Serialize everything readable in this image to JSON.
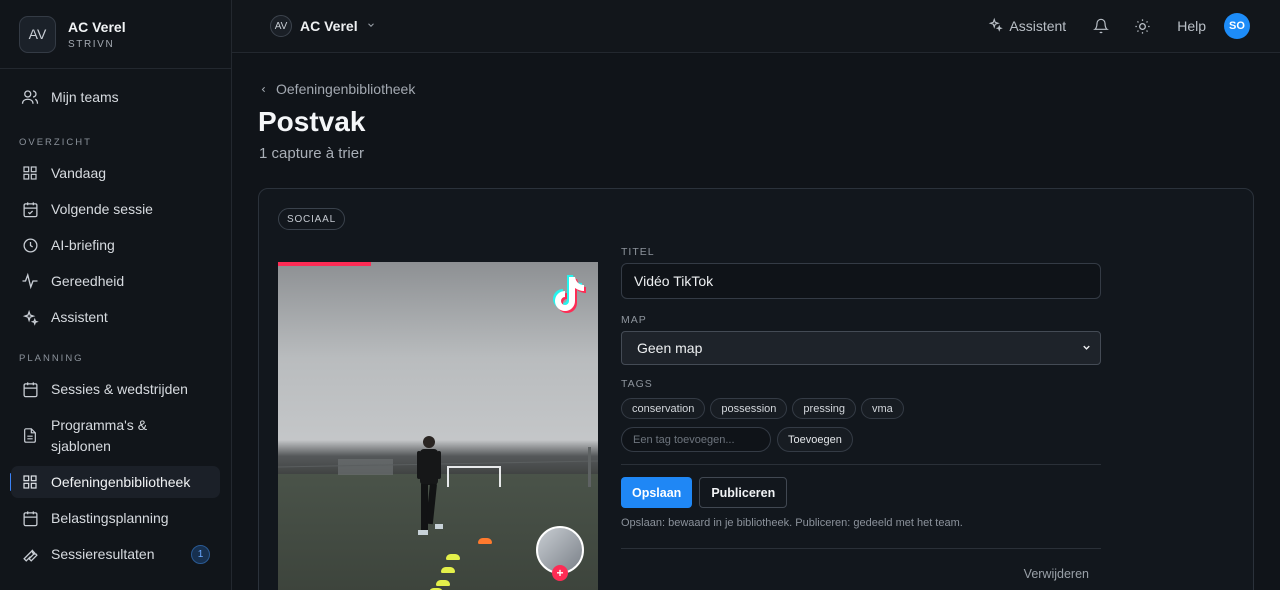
{
  "sidebar": {
    "team_initials": "AV",
    "team_name": "AC Verel",
    "team_org": "STRIVN",
    "my_teams": "Mijn teams",
    "section_overview": "OVERZICHT",
    "overview_items": [
      "Vandaag",
      "Volgende sessie",
      "AI-briefing",
      "Gereedheid",
      "Assistent"
    ],
    "section_planning": "PLANNING",
    "planning_items": [
      "Sessies & wedstrijden",
      "Programma's & sjablonen",
      "Oefeningenbibliotheek",
      "Belastingsplanning",
      "Sessieresultaten"
    ],
    "results_badge": "1"
  },
  "topbar": {
    "team_initials": "AV",
    "team_name": "AC Verel",
    "assistant_label": "Assistent",
    "help_label": "Help",
    "user_initials": "SO"
  },
  "main": {
    "breadcrumb": "Oefeningenbibliotheek",
    "title": "Postvak",
    "subtitle": "1 capture à trier",
    "card": {
      "source_tag": "SOCIAAL",
      "title_label": "TITEL",
      "title_value": "Vidéo TikTok",
      "map_label": "MAP",
      "map_value": "Geen map",
      "tags_label": "TAGS",
      "tags": [
        "conservation",
        "possession",
        "pressing",
        "vma"
      ],
      "tag_placeholder": "Een tag toevoegen...",
      "add_tag_label": "Toevoegen",
      "save_label": "Opslaan",
      "publish_label": "Publiceren",
      "hint": "Opslaan: bewaard in je bibliotheek. Publiceren: gedeeld met het team.",
      "delete_label": "Verwijderen"
    }
  },
  "colors": {
    "accent": "#1f87f5",
    "tiktok_red": "#fe2c55",
    "tiktok_cyan": "#25f4ee"
  }
}
